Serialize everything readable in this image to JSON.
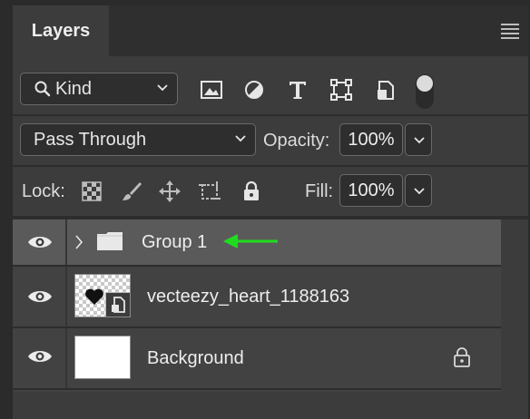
{
  "panel": {
    "tab_label": "Layers",
    "menu_icon": "hamburger-menu-icon"
  },
  "filter": {
    "kind_label": "Kind",
    "icons": [
      "image-filter-icon",
      "adjustment-filter-icon",
      "type-filter-icon",
      "shape-filter-icon",
      "smart-object-filter-icon"
    ]
  },
  "blend": {
    "mode": "Pass Through",
    "opacity_label": "Opacity:",
    "opacity_value": "100%"
  },
  "lock": {
    "label": "Lock:",
    "icons": [
      "lock-transparent-pixels-icon",
      "lock-image-pixels-icon",
      "lock-position-icon",
      "lock-artboard-icon",
      "lock-all-icon"
    ],
    "fill_label": "Fill:",
    "fill_value": "100%"
  },
  "layers": [
    {
      "name": "Group 1",
      "type": "group",
      "selected": true,
      "visible": true
    },
    {
      "name": "vecteezy_heart_1188163",
      "type": "smart-object",
      "visible": true
    },
    {
      "name": "Background",
      "type": "background",
      "locked": true,
      "visible": true
    }
  ],
  "colors": {
    "panel_bg": "#3c3c3c",
    "selected_row": "#5a5a5a",
    "annotation_arrow": "#1fdc1f"
  }
}
